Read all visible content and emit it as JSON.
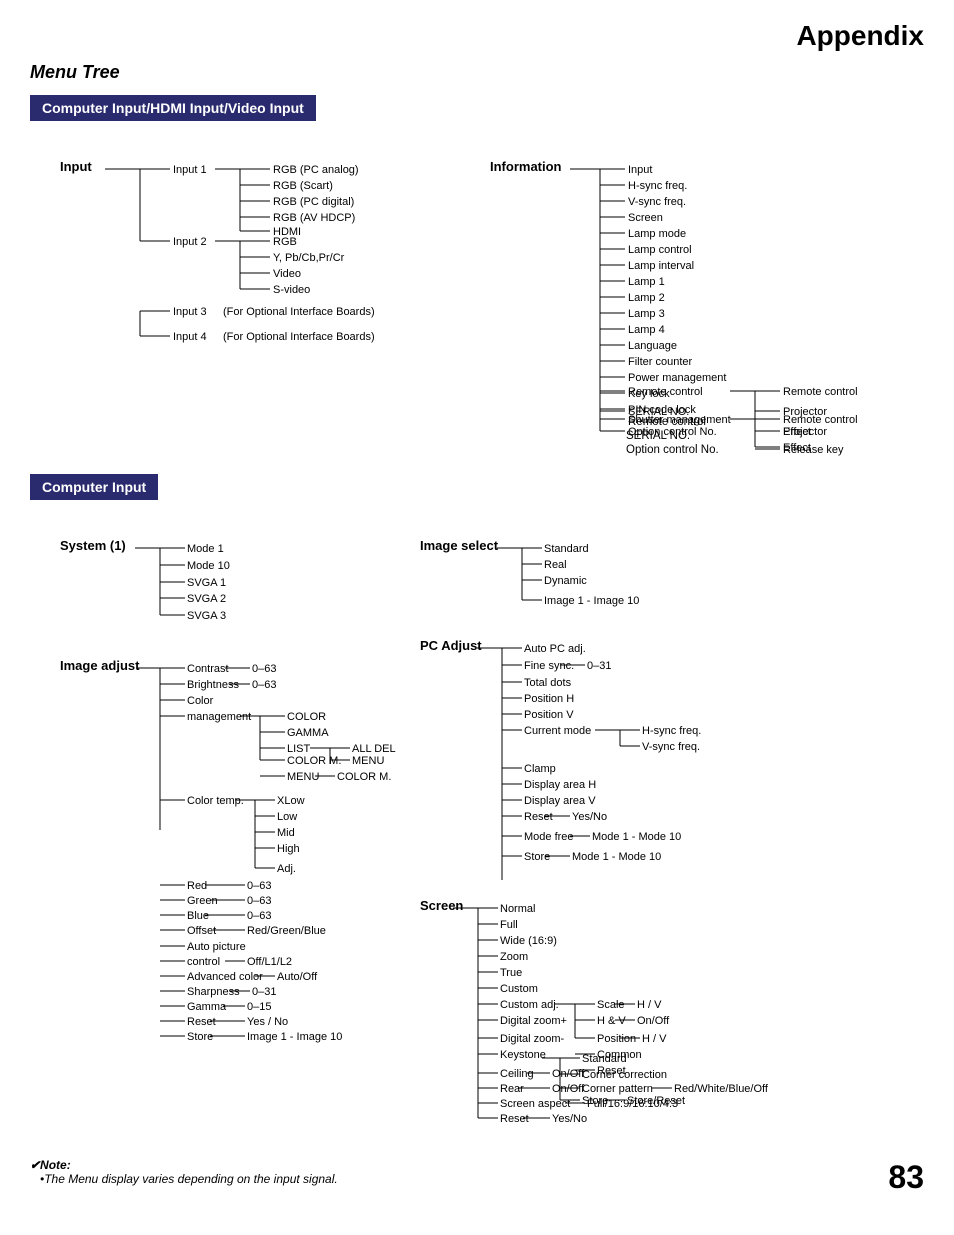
{
  "page": {
    "title": "Appendix",
    "subtitle": "Menu Tree",
    "page_number": "83"
  },
  "section1": {
    "header": "Computer Input/HDMI Input/Video Input"
  },
  "section2": {
    "header": "Computer Input"
  },
  "note": {
    "title": "✔Note:",
    "text": "•The Menu display varies depending on the input signal."
  }
}
